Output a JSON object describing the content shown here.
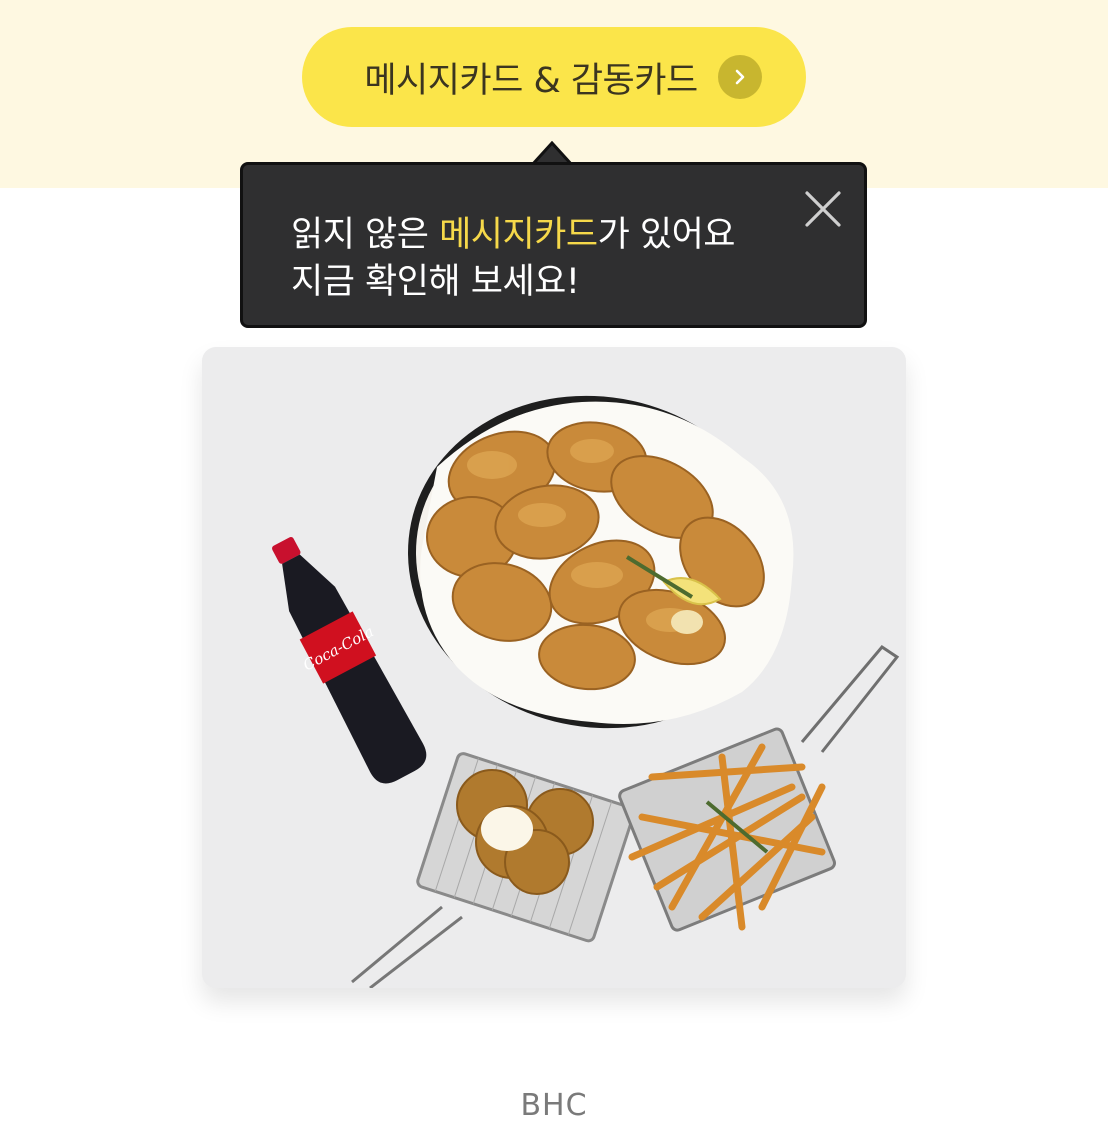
{
  "banner": {
    "button_label": "메시지카드 & 감동카드",
    "button_color": "#fbe54a",
    "chevron_icon": "chevron-right-icon"
  },
  "tooltip": {
    "line1_prefix": "읽지 않은 ",
    "line1_highlight": "메시지카드",
    "line1_suffix": "가 있어요",
    "line2": "지금 확인해 보세요!",
    "highlight_color": "#f6d94a",
    "close_icon": "close-icon"
  },
  "product": {
    "image_icon": "chicken-set-image",
    "bottle_label": "Coca-Cola"
  },
  "brand": {
    "name": "BHC"
  }
}
